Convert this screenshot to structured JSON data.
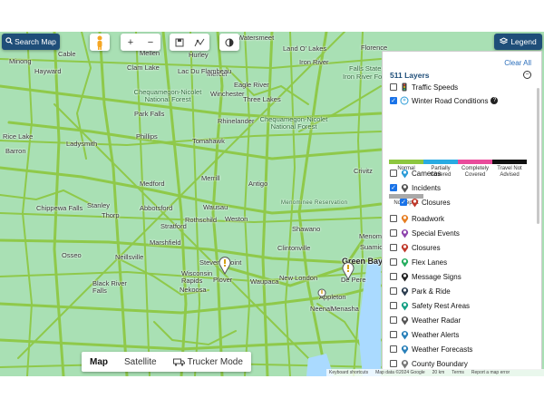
{
  "toolbar": {
    "search_map_label": "Search Map",
    "legend_label": "Legend",
    "zoom_in": "+",
    "zoom_out": "−"
  },
  "map": {
    "places": [
      "Cable",
      "Hayward",
      "Mellen",
      "Hurley",
      "Watersmeet",
      "Minong",
      "Clam Lake",
      "Mercer",
      "Land O' Lakes",
      "Iron River",
      "Florence",
      "Falls State Forest",
      "Iron River Forest",
      "Chequamegon-Nicolet National Forest",
      "Lac Du Flambeau",
      "Winchester",
      "Eagle River",
      "Three Lakes",
      "Park Falls",
      "Phillips",
      "Rhinelander",
      "Chequamegon-Nicolet National Forest",
      "Rice Lake",
      "Ladysmith",
      "Tomahawk",
      "Barron",
      "Crivitz",
      "Medford",
      "Merrill",
      "Antigo",
      "Menominee Reservation",
      "Chippewa Falls",
      "Stanley",
      "Thorp",
      "Abbotsford",
      "Wausau",
      "Rothschild",
      "Stratford",
      "Weston",
      "Shawano",
      "Marshfield",
      "Menominee",
      "Neillsville",
      "Stevens Point",
      "Clintonville",
      "Osseo",
      "Green Bay",
      "Suamico",
      "Black River Falls",
      "Wisconsin Rapids",
      "Plover",
      "Waupaca",
      "New London",
      "De Pere",
      "Nekoosa",
      "Appleton",
      "Neenah",
      "Menasha"
    ],
    "map_types": [
      "Map",
      "Satellite",
      "Trucker Mode"
    ],
    "attribution": [
      "Keyboard shortcuts",
      "Map data ©2024 Google",
      "20 km",
      "Terms",
      "Report a map error"
    ]
  },
  "legend": {
    "title": "511 Layers",
    "clear_all": "Clear All",
    "layers_top": [
      {
        "label": "Traffic Speeds",
        "checked": false,
        "icon": "traffic-speeds-icon"
      },
      {
        "label": "Winter Road Conditions",
        "checked": true,
        "icon": "winter-road-icon"
      }
    ],
    "winter_scale": [
      {
        "label": "Normal",
        "color": "#8dc63f"
      },
      {
        "label": "Partially Covered",
        "color": "#29abe2"
      },
      {
        "label": "Completely Covered",
        "color": "#e94b9b"
      },
      {
        "label": "Travel Not Advised",
        "color": "#111111"
      }
    ],
    "no_report": {
      "label": "No Report",
      "color": "#a9a9a9"
    },
    "layers": [
      {
        "label": "Cameras",
        "checked": false,
        "icon": "camera-icon",
        "color": "#2a9bd7"
      },
      {
        "label": "Incidents",
        "checked": true,
        "icon": "incident-icon",
        "color": "#555555"
      },
      {
        "label": "Closures",
        "checked": true,
        "icon": "closure-icon",
        "color": "#c0392b"
      },
      {
        "label": "Roadwork",
        "checked": false,
        "icon": "roadwork-icon",
        "color": "#e67e22"
      },
      {
        "label": "Special Events",
        "checked": false,
        "icon": "special-events-icon",
        "color": "#8e44ad"
      },
      {
        "label": "Closures",
        "checked": false,
        "icon": "closure-icon",
        "color": "#c0392b"
      },
      {
        "label": "Flex Lanes",
        "checked": false,
        "icon": "flex-lanes-icon",
        "color": "#27ae60"
      },
      {
        "label": "Message Signs",
        "checked": false,
        "icon": "message-sign-icon",
        "color": "#222222"
      },
      {
        "label": "Park & Ride",
        "checked": false,
        "icon": "park-ride-icon",
        "color": "#2c3e50"
      },
      {
        "label": "Safety Rest Areas",
        "checked": false,
        "icon": "rest-area-icon",
        "color": "#16a085"
      },
      {
        "label": "Weather Radar",
        "checked": false,
        "icon": "weather-radar-icon",
        "color": "#555555"
      },
      {
        "label": "Weather Alerts",
        "checked": false,
        "icon": "weather-alert-icon",
        "color": "#2980b9"
      },
      {
        "label": "Weather Forecasts",
        "checked": false,
        "icon": "weather-forecast-icon",
        "color": "#2980b9"
      },
      {
        "label": "County Boundary",
        "checked": false,
        "icon": "county-boundary-icon",
        "color": "#777777"
      }
    ]
  }
}
